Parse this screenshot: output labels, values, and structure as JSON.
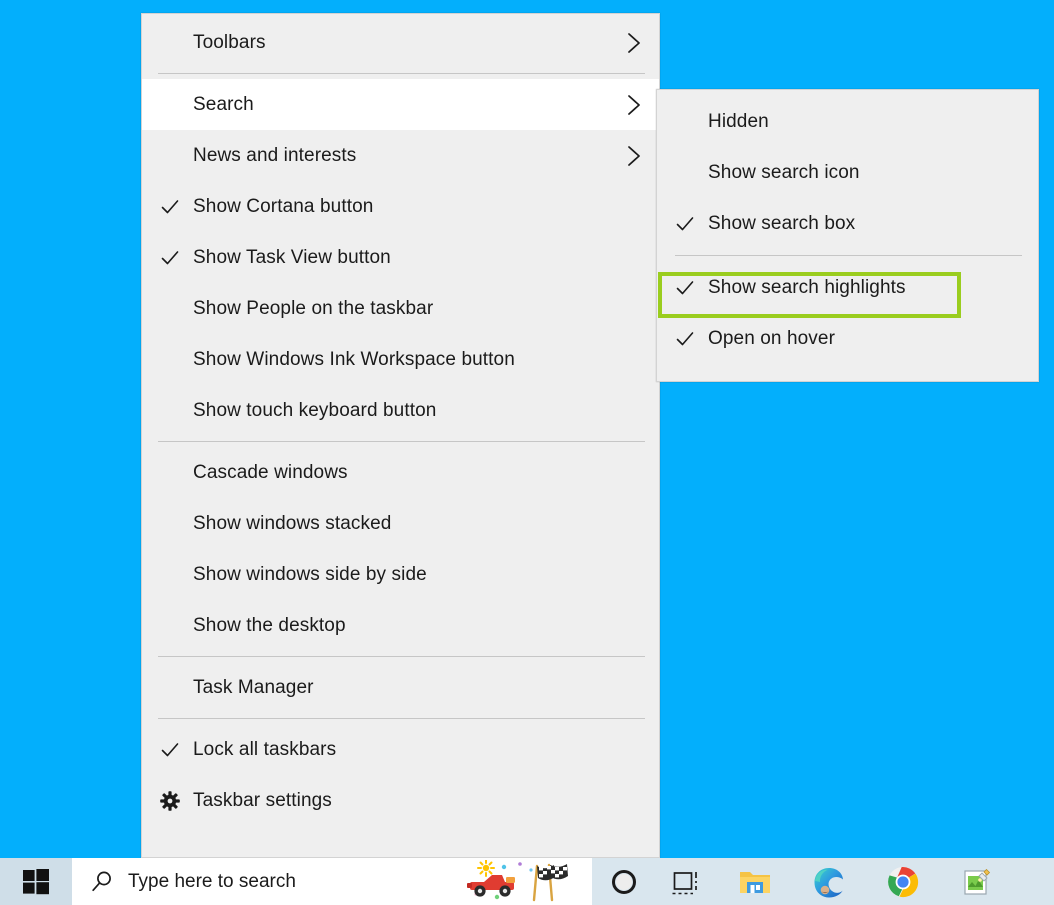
{
  "desktop": {
    "background_color": "#03AFFC"
  },
  "context_menu": {
    "name": "taskbar-context-menu",
    "items": [
      {
        "label": "Toolbars",
        "glyph": "none",
        "submenu": true,
        "selected": false
      },
      {
        "separator": true
      },
      {
        "label": "Search",
        "glyph": "none",
        "submenu": true,
        "selected": true
      },
      {
        "label": "News and interests",
        "glyph": "none",
        "submenu": true,
        "selected": false
      },
      {
        "label": "Show Cortana button",
        "glyph": "check",
        "submenu": false,
        "selected": false
      },
      {
        "label": "Show Task View button",
        "glyph": "check",
        "submenu": false,
        "selected": false
      },
      {
        "label": "Show People on the taskbar",
        "glyph": "none",
        "submenu": false,
        "selected": false
      },
      {
        "label": "Show Windows Ink Workspace button",
        "glyph": "none",
        "submenu": false,
        "selected": false
      },
      {
        "label": "Show touch keyboard button",
        "glyph": "none",
        "submenu": false,
        "selected": false
      },
      {
        "separator": true
      },
      {
        "label": "Cascade windows",
        "glyph": "none",
        "submenu": false,
        "selected": false
      },
      {
        "label": "Show windows stacked",
        "glyph": "none",
        "submenu": false,
        "selected": false
      },
      {
        "label": "Show windows side by side",
        "glyph": "none",
        "submenu": false,
        "selected": false
      },
      {
        "label": "Show the desktop",
        "glyph": "none",
        "submenu": false,
        "selected": false
      },
      {
        "separator": true
      },
      {
        "label": "Task Manager",
        "glyph": "none",
        "submenu": false,
        "selected": false
      },
      {
        "separator": true
      },
      {
        "label": "Lock all taskbars",
        "glyph": "check",
        "submenu": false,
        "selected": false
      },
      {
        "label": "Taskbar settings",
        "glyph": "gear",
        "submenu": false,
        "selected": false
      }
    ]
  },
  "submenu": {
    "name": "search-submenu",
    "parent": "Search",
    "items": [
      {
        "label": "Hidden",
        "glyph": "none",
        "selected": false
      },
      {
        "label": "Show search icon",
        "glyph": "none",
        "selected": false
      },
      {
        "label": "Show search box",
        "glyph": "check",
        "selected": false
      },
      {
        "separator": true
      },
      {
        "label": "Show search highlights",
        "glyph": "check",
        "selected": false,
        "annotated": true
      },
      {
        "label": "Open on hover",
        "glyph": "check",
        "selected": false
      }
    ]
  },
  "annotation": {
    "target_label": "Show search highlights",
    "color": "#9ACD1E"
  },
  "taskbar": {
    "background_color": "#D9E6EE",
    "start_button_label": "Start",
    "search": {
      "placeholder": "Type here to search",
      "value": ""
    },
    "icons": [
      {
        "name": "cortana-icon",
        "label": "Cortana"
      },
      {
        "name": "task-view-icon",
        "label": "Task View"
      },
      {
        "name": "file-explorer-icon",
        "label": "File Explorer"
      },
      {
        "name": "microsoft-edge-icon",
        "label": "Microsoft Edge"
      },
      {
        "name": "google-chrome-icon",
        "label": "Google Chrome"
      },
      {
        "name": "notepad-editor-icon",
        "label": "Editor"
      }
    ]
  }
}
